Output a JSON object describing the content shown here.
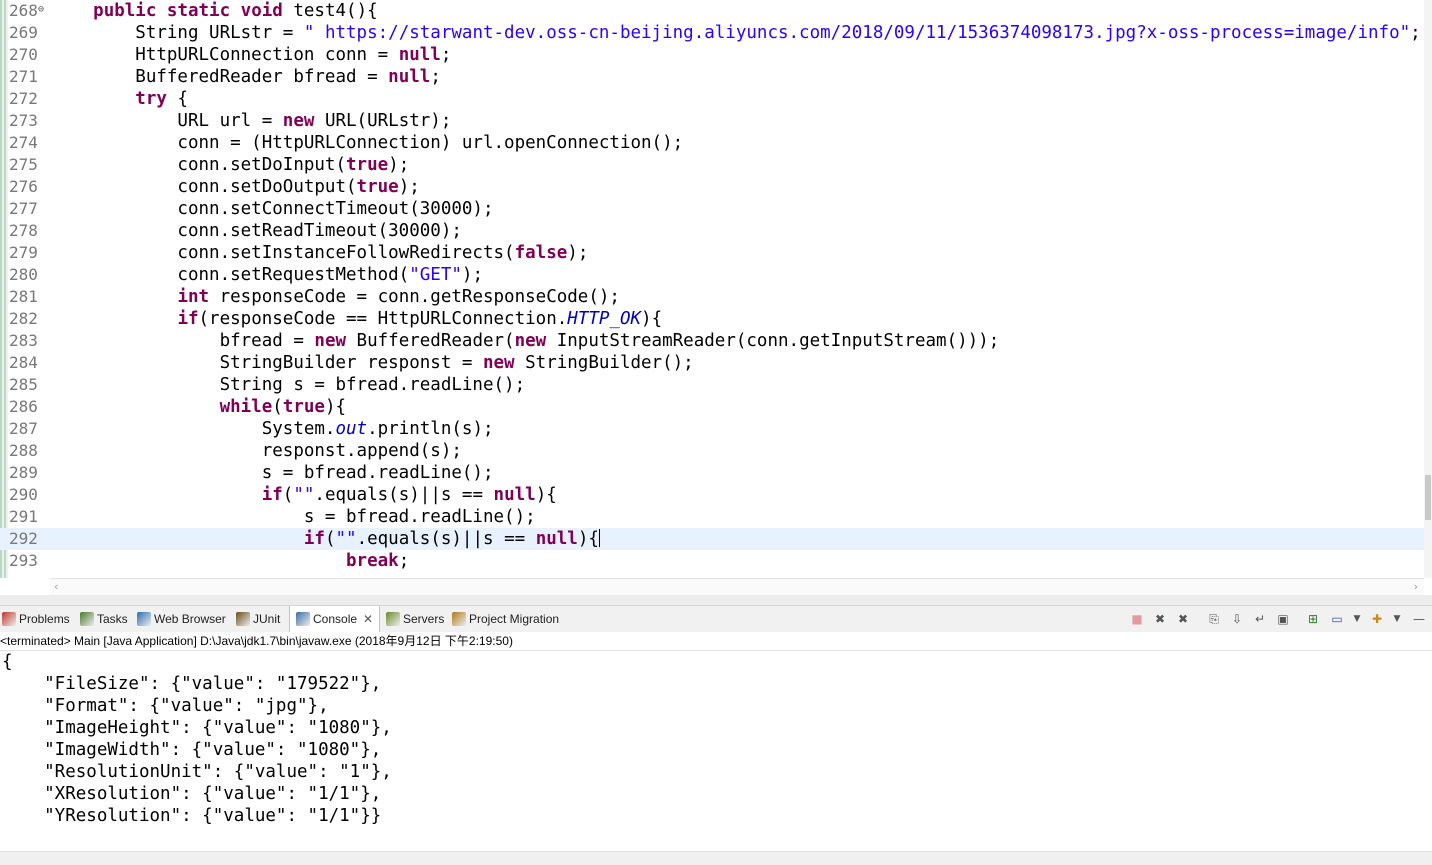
{
  "editor": {
    "lines": [
      {
        "num": "268",
        "fold": "⊖",
        "tokens": [
          {
            "t": "    "
          },
          {
            "t": "public static void",
            "c": "kw"
          },
          {
            "t": " test4(){"
          }
        ]
      },
      {
        "num": "269",
        "tokens": [
          {
            "t": "        String URLstr = "
          },
          {
            "t": "\" https://starwant-dev.oss-cn-beijing.aliyuncs.com/2018/09/11/1536374098173.jpg?x-oss-process=image/info\"",
            "c": "str"
          },
          {
            "t": ";"
          }
        ]
      },
      {
        "num": "270",
        "tokens": [
          {
            "t": "        HttpURLConnection conn = "
          },
          {
            "t": "null",
            "c": "kw"
          },
          {
            "t": ";"
          }
        ]
      },
      {
        "num": "271",
        "tokens": [
          {
            "t": "        BufferedReader bfread = "
          },
          {
            "t": "null",
            "c": "kw"
          },
          {
            "t": ";"
          }
        ]
      },
      {
        "num": "272",
        "tokens": [
          {
            "t": "        "
          },
          {
            "t": "try",
            "c": "kw"
          },
          {
            "t": " {"
          }
        ]
      },
      {
        "num": "273",
        "tokens": [
          {
            "t": "            URL url = "
          },
          {
            "t": "new",
            "c": "kw"
          },
          {
            "t": " URL(URLstr);"
          }
        ]
      },
      {
        "num": "274",
        "tokens": [
          {
            "t": "            conn = (HttpURLConnection) url.openConnection();"
          }
        ]
      },
      {
        "num": "275",
        "tokens": [
          {
            "t": "            conn.setDoInput("
          },
          {
            "t": "true",
            "c": "kw"
          },
          {
            "t": ");"
          }
        ]
      },
      {
        "num": "276",
        "tokens": [
          {
            "t": "            conn.setDoOutput("
          },
          {
            "t": "true",
            "c": "kw"
          },
          {
            "t": ");"
          }
        ]
      },
      {
        "num": "277",
        "tokens": [
          {
            "t": "            conn.setConnectTimeout(30000);"
          }
        ]
      },
      {
        "num": "278",
        "tokens": [
          {
            "t": "            conn.setReadTimeout(30000);"
          }
        ]
      },
      {
        "num": "279",
        "tokens": [
          {
            "t": "            conn.setInstanceFollowRedirects("
          },
          {
            "t": "false",
            "c": "kw"
          },
          {
            "t": ");"
          }
        ]
      },
      {
        "num": "280",
        "tokens": [
          {
            "t": "            conn.setRequestMethod("
          },
          {
            "t": "\"GET\"",
            "c": "str"
          },
          {
            "t": ");"
          }
        ]
      },
      {
        "num": "281",
        "tokens": [
          {
            "t": "            "
          },
          {
            "t": "int",
            "c": "kw"
          },
          {
            "t": " responseCode = conn.getResponseCode();"
          }
        ]
      },
      {
        "num": "282",
        "tokens": [
          {
            "t": "            "
          },
          {
            "t": "if",
            "c": "kw"
          },
          {
            "t": "(responseCode == HttpURLConnection."
          },
          {
            "t": "HTTP_OK",
            "c": "fld"
          },
          {
            "t": "){"
          }
        ]
      },
      {
        "num": "283",
        "tokens": [
          {
            "t": "                bfread = "
          },
          {
            "t": "new",
            "c": "kw"
          },
          {
            "t": " BufferedReader("
          },
          {
            "t": "new",
            "c": "kw"
          },
          {
            "t": " InputStreamReader(conn.getInputStream()));"
          }
        ]
      },
      {
        "num": "284",
        "tokens": [
          {
            "t": "                StringBuilder responst = "
          },
          {
            "t": "new",
            "c": "kw"
          },
          {
            "t": " StringBuilder();"
          }
        ]
      },
      {
        "num": "285",
        "tokens": [
          {
            "t": "                String s = bfread.readLine();"
          }
        ]
      },
      {
        "num": "286",
        "tokens": [
          {
            "t": "                "
          },
          {
            "t": "while",
            "c": "kw"
          },
          {
            "t": "("
          },
          {
            "t": "true",
            "c": "kw"
          },
          {
            "t": "){"
          }
        ]
      },
      {
        "num": "287",
        "tokens": [
          {
            "t": "                    System."
          },
          {
            "t": "out",
            "c": "fld"
          },
          {
            "t": ".println(s);"
          }
        ]
      },
      {
        "num": "288",
        "tokens": [
          {
            "t": "                    responst.append(s);"
          }
        ]
      },
      {
        "num": "289",
        "tokens": [
          {
            "t": "                    s = bfread.readLine();"
          }
        ]
      },
      {
        "num": "290",
        "tokens": [
          {
            "t": "                    "
          },
          {
            "t": "if",
            "c": "kw"
          },
          {
            "t": "("
          },
          {
            "t": "\"\"",
            "c": "str"
          },
          {
            "t": ".equals(s)||s == "
          },
          {
            "t": "null",
            "c": "kw"
          },
          {
            "t": "){"
          }
        ]
      },
      {
        "num": "291",
        "tokens": [
          {
            "t": "                        s = bfread.readLine();"
          }
        ]
      },
      {
        "num": "292",
        "current": true,
        "tokens": [
          {
            "t": "                        "
          },
          {
            "t": "if",
            "c": "kw"
          },
          {
            "t": "("
          },
          {
            "t": "\"\"",
            "c": "str"
          },
          {
            "t": ".equals(s)||s == "
          },
          {
            "t": "null",
            "c": "kw"
          },
          {
            "t": "){"
          }
        ]
      },
      {
        "num": "293",
        "tokens": [
          {
            "t": "                            "
          },
          {
            "t": "break",
            "c": "kw"
          },
          {
            "t": ";"
          }
        ]
      }
    ]
  },
  "panel": {
    "tabs": [
      {
        "label": "Problems",
        "icon": "problems-icon"
      },
      {
        "label": "Tasks",
        "icon": "tasks-icon"
      },
      {
        "label": "Web Browser",
        "icon": "web-browser-icon"
      },
      {
        "label": "JUnit",
        "icon": "junit-icon"
      },
      {
        "label": "Console",
        "icon": "console-icon",
        "active": true
      },
      {
        "label": "Servers",
        "icon": "servers-icon"
      },
      {
        "label": "Project Migration",
        "icon": "project-migration-icon"
      }
    ],
    "console_status": "<terminated> Main [Java Application] D:\\Java\\jdk1.7\\bin\\javaw.exe (2018年9月12日 下午2:19:50)"
  },
  "console_output": [
    "{",
    "    \"FileSize\": {\"value\": \"179522\"},",
    "    \"Format\": {\"value\": \"jpg\"},",
    "    \"ImageHeight\": {\"value\": \"1080\"},",
    "    \"ImageWidth\": {\"value\": \"1080\"},",
    "    \"ResolutionUnit\": {\"value\": \"1\"},",
    "    \"XResolution\": {\"value\": \"1/1\"},",
    "    \"YResolution\": {\"value\": \"1/1\"}}"
  ],
  "colors": {
    "keyword": "#7f0055",
    "string": "#2a00ff",
    "field": "#0000c0",
    "current_line": "#e8f2fe"
  }
}
